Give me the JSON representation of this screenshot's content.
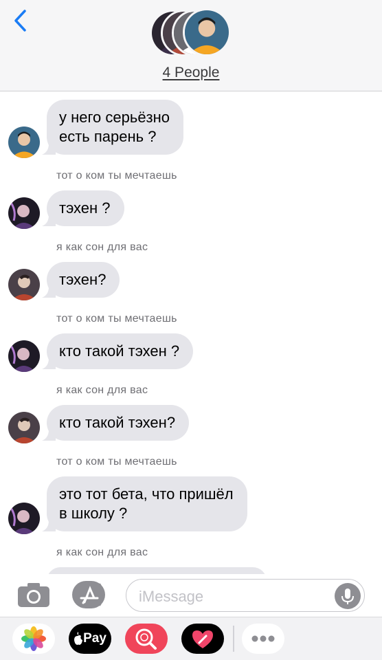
{
  "header": {
    "people_label": "4 People"
  },
  "messages": [
    {
      "sender": "",
      "text": "у него серьёзно\nесть парень ?",
      "avatar": "orange-hoodie"
    },
    {
      "sender": "тот о ком ты мечтаешь",
      "text": "тэхен ?",
      "avatar": "purple-dark"
    },
    {
      "sender": "я как сон для вас",
      "text": "тэхен?",
      "avatar": "red-shirt"
    },
    {
      "sender": "тот о ком ты мечтаешь",
      "text": "кто такой тэхен ?",
      "avatar": "purple-dark"
    },
    {
      "sender": "я как сон для вас",
      "text": "кто такой тэхен?",
      "avatar": "red-shirt"
    },
    {
      "sender": "тот о ком ты мечтаешь",
      "text": "это тот бета, что пришёл\nв школу ?",
      "avatar": "purple-dark"
    },
    {
      "sender": "я как сон для вас",
      "text": "",
      "avatar": ""
    }
  ],
  "input": {
    "placeholder": "iMessage"
  },
  "drawer": {
    "apps": [
      "photos-app",
      "apple-pay-app",
      "image-search-app",
      "digital-touch-app",
      "more-apps"
    ],
    "pay_label": "Pay"
  },
  "colors": {
    "accent": "#1a7cf5",
    "bubble_gray": "#e5e5ea",
    "header_bg": "#f6f6f7"
  }
}
